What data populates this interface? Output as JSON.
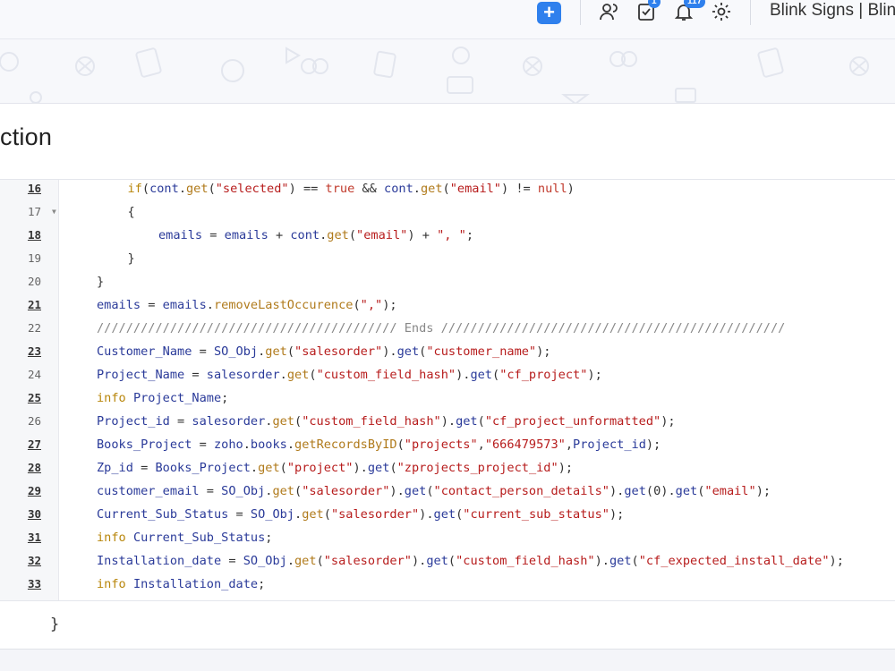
{
  "header": {
    "add_label": "+",
    "tasks_badge": "1",
    "notifications_badge": "117",
    "org_name": "Blink Signs | Blin"
  },
  "page": {
    "title": "ction"
  },
  "code": {
    "lines": [
      {
        "num": "16",
        "underline": true,
        "fold": "",
        "indent": 1,
        "text": "if(cont.get(\"selected\") == true && cont.get(\"email\") != null)"
      },
      {
        "num": "17",
        "underline": false,
        "fold": "▼",
        "indent": 1,
        "text": "{"
      },
      {
        "num": "18",
        "underline": true,
        "fold": "",
        "indent": 2,
        "text": "emails = emails + cont.get(\"email\") + \", \";"
      },
      {
        "num": "19",
        "underline": false,
        "fold": "",
        "indent": 1,
        "text": "}"
      },
      {
        "num": "20",
        "underline": false,
        "fold": "",
        "indent": 0,
        "text": "}"
      },
      {
        "num": "21",
        "underline": true,
        "fold": "",
        "indent": 0,
        "text": "emails = emails.removeLastOccurence(\",\");"
      },
      {
        "num": "22",
        "underline": false,
        "fold": "",
        "indent": 0,
        "text": "///////////////////////////////////////// Ends ///////////////////////////////////////////////"
      },
      {
        "num": "23",
        "underline": true,
        "fold": "",
        "indent": 0,
        "text": "Customer_Name = SO_Obj.get(\"salesorder\").get(\"customer_name\");"
      },
      {
        "num": "24",
        "underline": false,
        "fold": "",
        "indent": 0,
        "text": "Project_Name = salesorder.get(\"custom_field_hash\").get(\"cf_project\");"
      },
      {
        "num": "25",
        "underline": true,
        "fold": "",
        "indent": 0,
        "text": "info Project_Name;"
      },
      {
        "num": "26",
        "underline": false,
        "fold": "",
        "indent": 0,
        "text": "Project_id = salesorder.get(\"custom_field_hash\").get(\"cf_project_unformatted\");"
      },
      {
        "num": "27",
        "underline": true,
        "fold": "",
        "indent": 0,
        "text": "Books_Project = zoho.books.getRecordsByID(\"projects\",\"666479573\",Project_id);"
      },
      {
        "num": "28",
        "underline": true,
        "fold": "",
        "indent": 0,
        "text": "Zp_id = Books_Project.get(\"project\").get(\"zprojects_project_id\");"
      },
      {
        "num": "29",
        "underline": true,
        "fold": "",
        "indent": 0,
        "text": "customer_email = SO_Obj.get(\"salesorder\").get(\"contact_person_details\").get(0).get(\"email\");"
      },
      {
        "num": "30",
        "underline": true,
        "fold": "",
        "indent": 0,
        "text": "Current_Sub_Status = SO_Obj.get(\"salesorder\").get(\"current_sub_status\");"
      },
      {
        "num": "31",
        "underline": true,
        "fold": "",
        "indent": 0,
        "text": "info Current_Sub_Status;"
      },
      {
        "num": "32",
        "underline": true,
        "fold": "",
        "indent": 0,
        "text": "Installation_date = SO_Obj.get(\"salesorder\").get(\"custom_field_hash\").get(\"cf_expected_install_date\");"
      },
      {
        "num": "33",
        "underline": true,
        "fold": "",
        "indent": 0,
        "text": "info Installation_date;"
      }
    ],
    "closing_brace": "}"
  },
  "colors": {
    "accent": "#2f80ed",
    "string": "#b71c1c",
    "method": "#b07a1b",
    "variable": "#2a3a99"
  }
}
